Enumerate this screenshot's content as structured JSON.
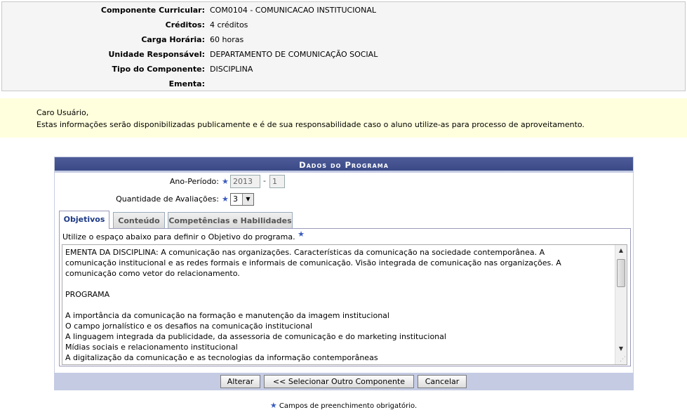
{
  "component_info": {
    "rows": [
      {
        "label": "Componente Curricular:",
        "value": "COM0104 - COMUNICACAO INSTITUCIONAL"
      },
      {
        "label": "Créditos:",
        "value": "4 créditos"
      },
      {
        "label": "Carga Horária:",
        "value": "60 horas"
      },
      {
        "label": "Unidade Responsável:",
        "value": "DEPARTAMENTO DE COMUNICAÇÃO SOCIAL"
      },
      {
        "label": "Tipo do Componente:",
        "value": "DISCIPLINA"
      },
      {
        "label": "Ementa:",
        "value": ""
      }
    ]
  },
  "notice": {
    "line1": "Caro Usuário,",
    "line2": "Estas informações serão disponibilizadas publicamente e é de sua responsabilidade caso o aluno utilize-as para processo de aproveitamento."
  },
  "form": {
    "caption": "Dados do Programa",
    "ano_periodo_label": "Ano-Período:",
    "ano_value": "2013",
    "separator": "-",
    "periodo_value": "1",
    "avaliacoes_label": "Quantidade de Avaliações:",
    "avaliacoes_value": "3",
    "required_marker": "★"
  },
  "tabs": [
    {
      "label": "Objetivos",
      "active": true
    },
    {
      "label": "Conteúdo",
      "active": false
    },
    {
      "label": "Competências e Habilidades",
      "active": false
    }
  ],
  "objetivos": {
    "hint": "Utilize o espaço abaixo para definir o Objetivo do programa.",
    "lines": [
      "EMENTA DA DISCIPLINA: A comunicação nas organizações. Características da comunicação na sociedade contemporânea. A",
      "comunicação institucional e as redes formais e informais de comunicação. Visão integrada de comunicação nas organizações.  A",
      "comunicação como vetor do relacionamento.",
      "",
      "PROGRAMA",
      "",
      "A importância da comunicação na formação e manutenção da imagem institucional",
      "O campo jornalístico e os desafios na comunicação institucional",
      "A linguagem integrada da publicidade, da assessoria de comunicação e do marketing  institucional",
      "Mídias sociais e relacionamento institucional",
      "A digitalização da comunicação e as tecnologias da informação contemporâneas"
    ]
  },
  "buttons": {
    "alterar": "Alterar",
    "selecionar": "<< Selecionar Outro Componente",
    "cancelar": "Cancelar"
  },
  "legend": {
    "marker": "★",
    "text": "Campos de preenchimento obrigatório."
  },
  "colors": {
    "caption_bg": "#3a4a86",
    "notice_bg": "#ffffdd",
    "footer_bg": "#c4cbe3",
    "required": "#3a5bbf"
  }
}
